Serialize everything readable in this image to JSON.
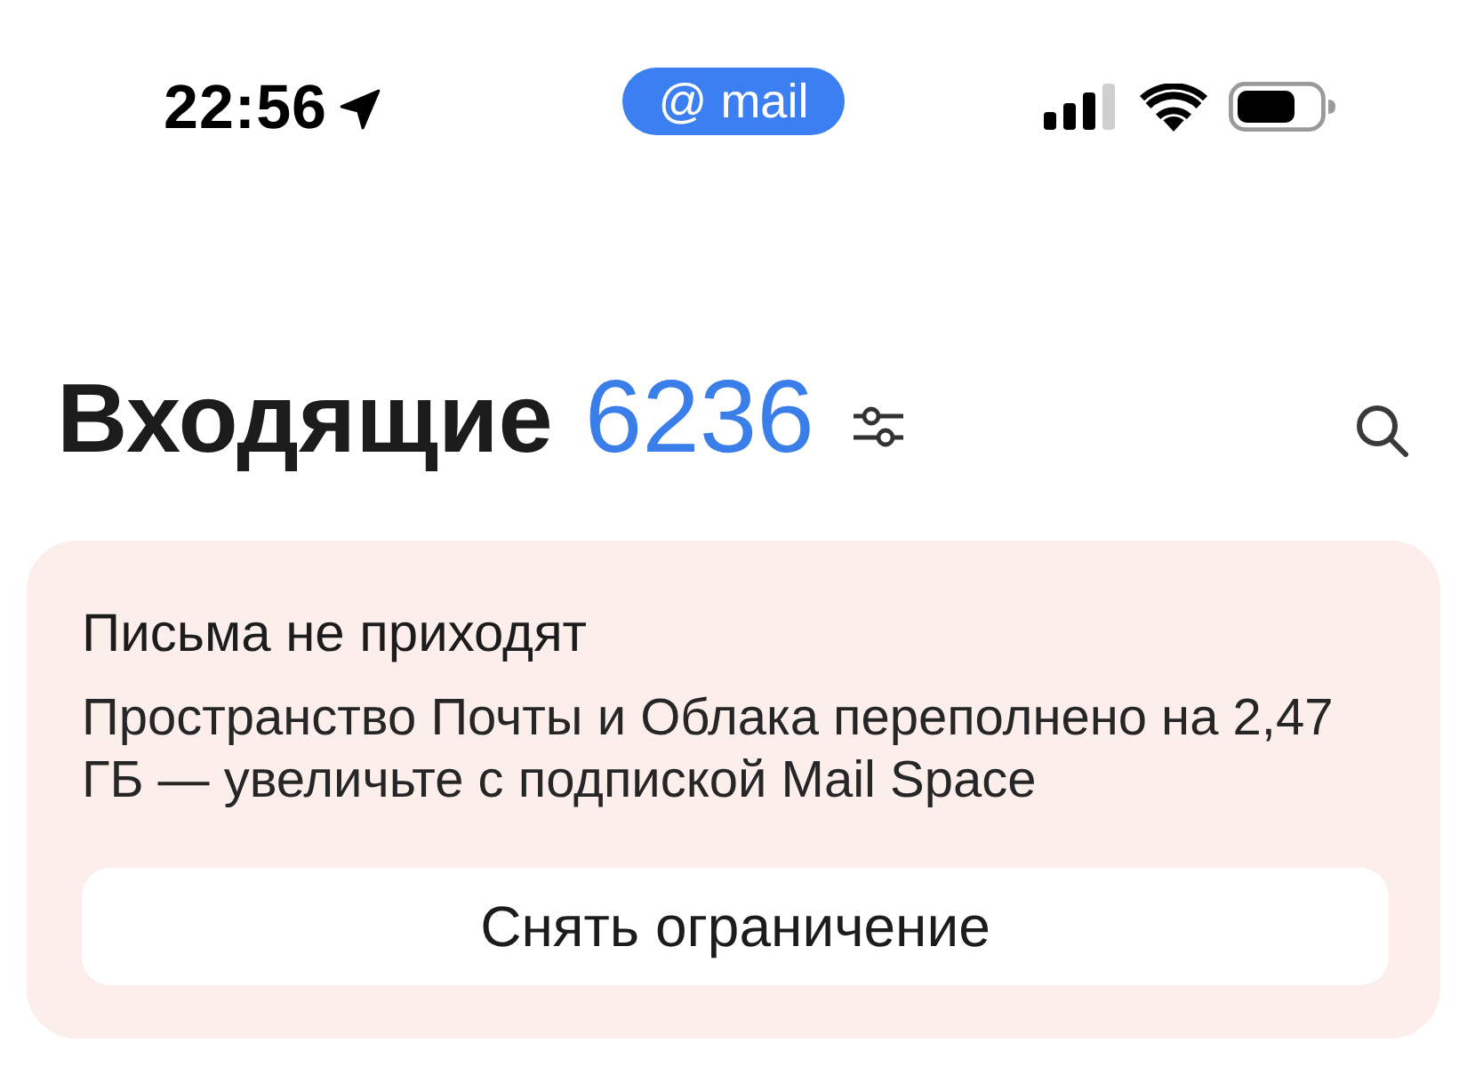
{
  "status_bar": {
    "time": "22:56",
    "app_pill": "@ mail"
  },
  "header": {
    "title": "Входящие",
    "count": "6236"
  },
  "banner": {
    "title": "Письма не приходят",
    "text": "Пространство Почты и Облака переполнено на 2,47 ГБ — увеличьте с подпиской Mail Space",
    "button": "Снять ограничение"
  }
}
